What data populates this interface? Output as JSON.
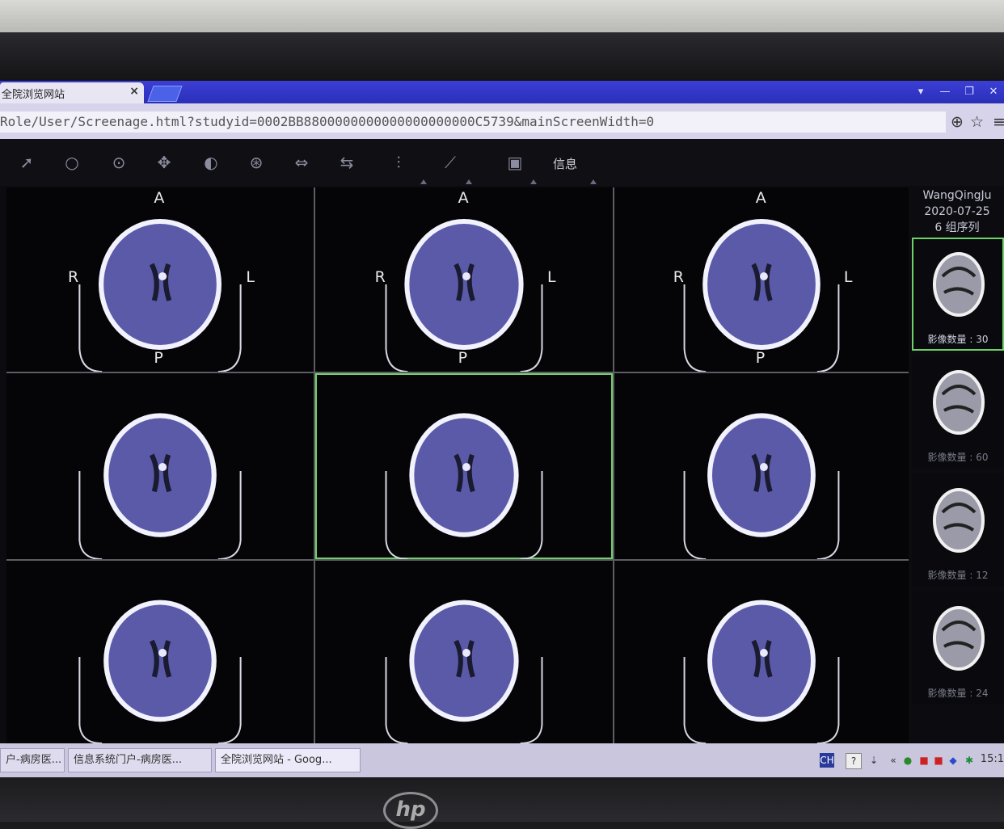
{
  "browser": {
    "tab_title": "全院浏览网站",
    "tab_close": "×",
    "url": "Role/User/Screenage.html?studyid=0002BB8800000000000000000000C5739&mainScreenWidth=0",
    "window_controls": [
      "▾",
      "—",
      "❐",
      "✕"
    ]
  },
  "toolbar": {
    "icons": [
      "pointer-icon",
      "zoom-icon",
      "magnify-icon",
      "pan-icon",
      "window-level-icon",
      "color-icon",
      "rotate-icon",
      "flip-icon",
      "adjust-icon",
      "measure-icon",
      "save-icon"
    ],
    "info_label": "信息"
  },
  "grid": {
    "orientation": {
      "anterior": "A",
      "posterior": "P",
      "right": "R",
      "left": "L"
    },
    "cells": [
      {
        "labels": true,
        "active": false
      },
      {
        "labels": true,
        "active": false
      },
      {
        "labels": true,
        "active": false
      },
      {
        "labels": false,
        "active": false
      },
      {
        "labels": false,
        "active": true
      },
      {
        "labels": false,
        "active": false
      },
      {
        "labels": false,
        "active": false
      },
      {
        "labels": false,
        "active": false
      },
      {
        "labels": false,
        "active": false
      }
    ]
  },
  "sidebar": {
    "patient_name": "WangQingJu",
    "study_date": "2020-07-25",
    "series_summary": "6 组序列",
    "series": [
      {
        "count_label": "影像数量 : 30",
        "selected": true
      },
      {
        "count_label": "影像数量 : 60",
        "selected": false
      },
      {
        "count_label": "影像数量 : 12",
        "selected": false
      },
      {
        "count_label": "影像数量 : 24",
        "selected": false
      }
    ]
  },
  "taskbar": {
    "tasks": [
      "户-病房医...",
      "信息系统门户-病房医...",
      "全院浏览网站 - Goog..."
    ],
    "tray": {
      "ime": "CH",
      "help": "?",
      "clock": "15:1"
    }
  },
  "colors": {
    "active_border": "#6fd16a",
    "brain": "#5a5aa8",
    "skull": "#f2f2ff"
  }
}
